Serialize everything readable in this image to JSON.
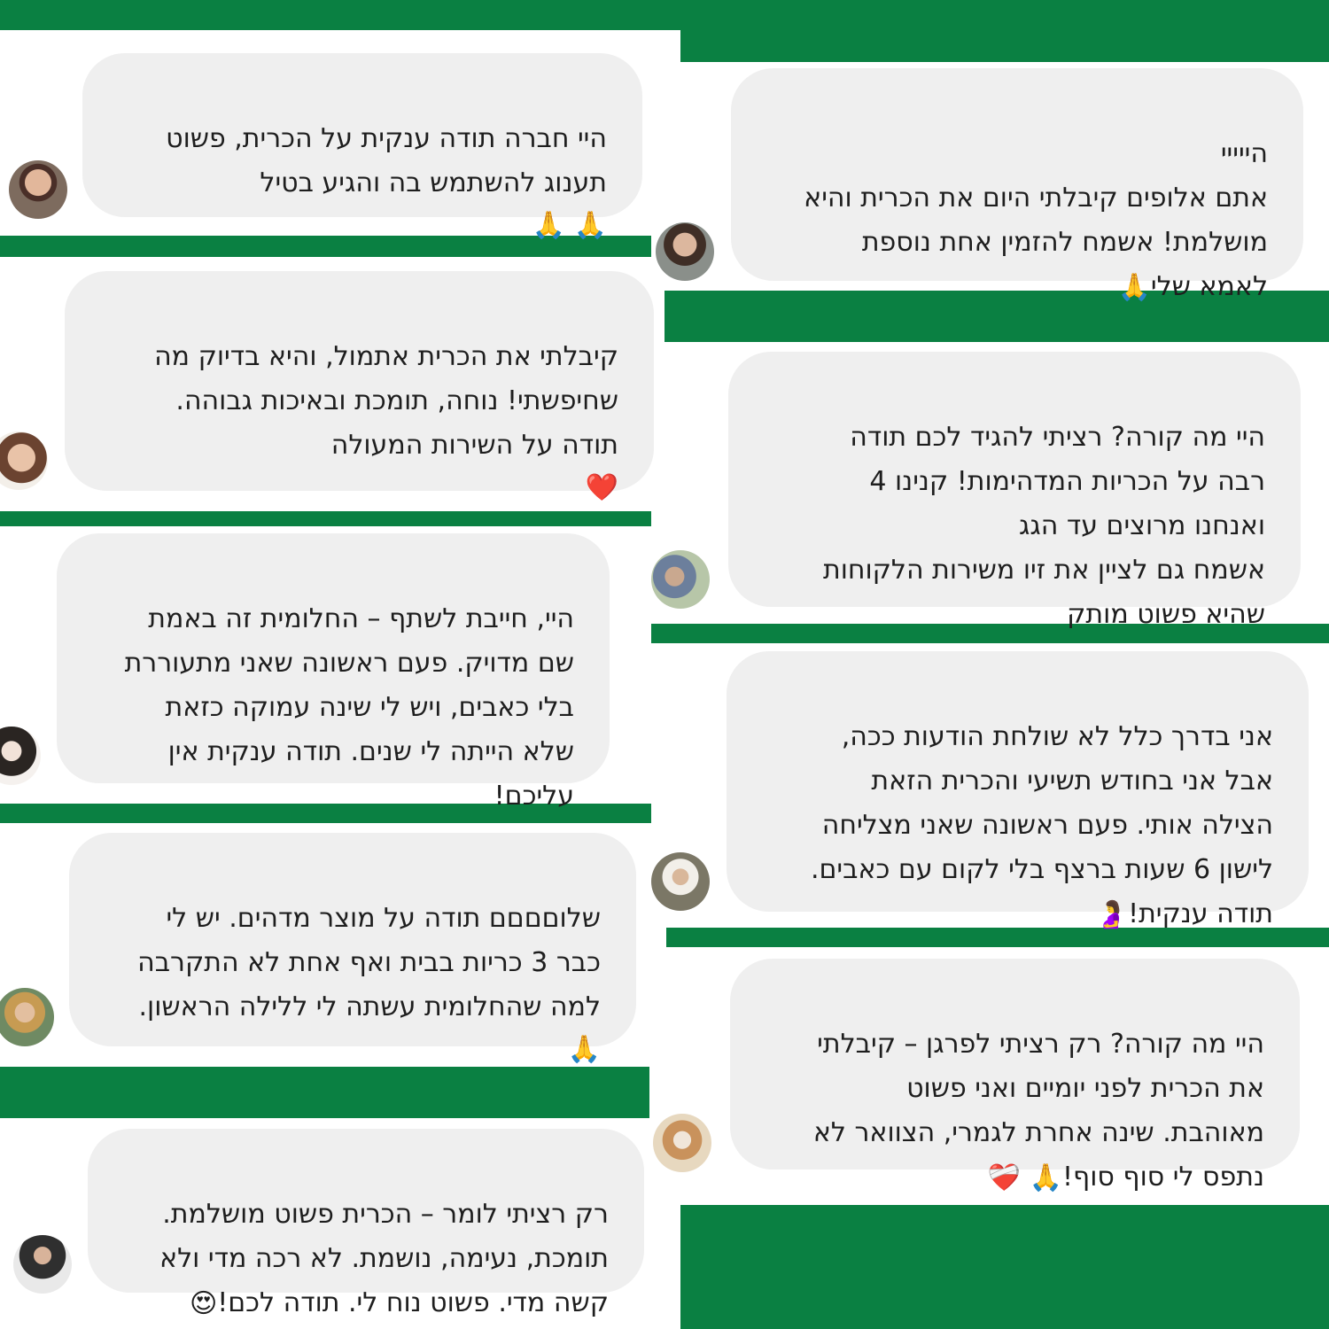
{
  "colors": {
    "brand_green": "#0a8042",
    "bubble": "#efefef",
    "text": "#1e1e1e"
  },
  "reviews": [
    {
      "text": "היי חברה תודה ענקית על הכרית, פשוט\nתענוג להשתמש בה והגיע בטיל",
      "emoji": "🙏 🙏"
    },
    {
      "text": "הייייי\nאתם אלופים קיבלתי היום את הכרית והיא\nמושלמת! אשמח להזמין אחת נוספת\nלאמא שלי",
      "emoji": "🙏"
    },
    {
      "text": "קיבלתי את הכרית אתמול, והיא בדיוק מה\nשחיפשתי! נוחה, תומכת ובאיכות גבוהה.\nתודה על השירות המעולה",
      "emoji": "❤️"
    },
    {
      "text": "היי מה קורה? רציתי להגיד לכם תודה\nרבה על הכריות המדהימות! קנינו 4\nואנחנו מרוצים עד הגג\nאשמח גם לציין את זיו משירות הלקוחות\nשהיא פשוט מותק"
    },
    {
      "text": "היי, חייבת לשתף – החלומית זה באמת\nשם מדויק. פעם ראשונה שאני מתעוררת\nבלי כאבים, ויש לי שינה עמוקה כזאת\nשלא הייתה לי שנים. תודה ענקית אין\nעליכם!"
    },
    {
      "text": "אני בדרך כלל לא שולחת הודעות ככה,\nאבל אני בחודש תשיעי והכרית הזאת\nהצילה אותי. פעם ראשונה שאני מצליחה\nלישון 6 שעות ברצף בלי לקום עם כאבים.\nתודה ענקית!",
      "emoji": "🤰"
    },
    {
      "text": "שלוםםםם תודה על מוצר מדהים. יש לי\nכבר 3 כריות בבית ואף אחת לא התקרבה\nלמה שהחלומית עשתה לי ללילה הראשון.",
      "emoji": "🙏"
    },
    {
      "text": "היי מה קורה? רק רציתי לפרגן – קיבלתי\nאת הכרית לפני יומיים ואני פשוט\nמאוהבת. שינה אחרת לגמרי, הצוואר לא\nנתפס לי סוף סוף!",
      "emoji": "🙏 ❤️‍🩹"
    },
    {
      "text": "רק רציתי לומר – הכרית פשוט מושלמת.\nתומכת, נעימה, נושמת. לא רכה מדי ולא\nקשה מדי. פשוט נוח לי. תודה לכם!",
      "emoji": "😍"
    }
  ]
}
